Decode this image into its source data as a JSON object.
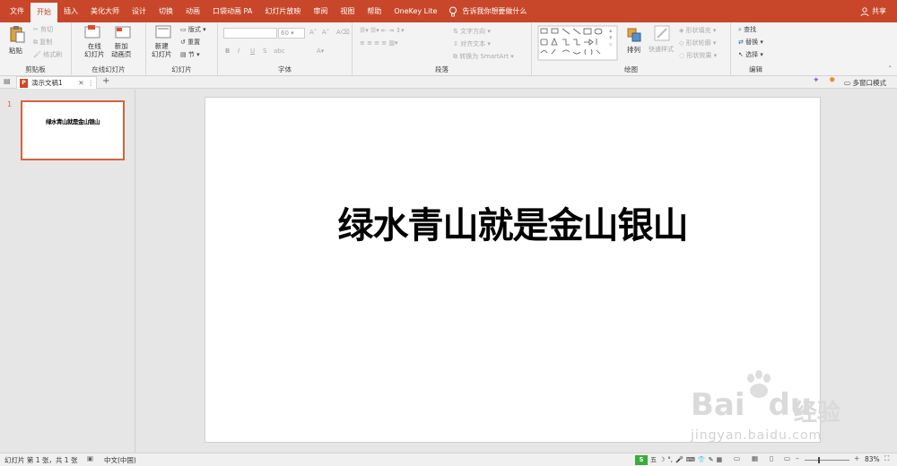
{
  "menubar": {
    "tabs": [
      "文件",
      "开始",
      "插入",
      "美化大师",
      "设计",
      "切换",
      "动画",
      "口袋动画 PA",
      "幻灯片放映",
      "审阅",
      "视图",
      "帮助",
      "OneKey Lite"
    ],
    "active_tab": "开始",
    "tell_me": "告诉我你想要做什么",
    "share": "共享"
  },
  "ribbon": {
    "clipboard": {
      "paste": "粘贴",
      "cut": "剪切",
      "copy": "复制",
      "format_painter": "格式刷",
      "group": "剪贴板"
    },
    "online_slides": {
      "online": "在线",
      "online2": "幻灯片",
      "new_anim": "新加",
      "new_anim2": "动画页",
      "group": "在线幻灯片"
    },
    "slides": {
      "new": "新建",
      "new2": "幻灯片",
      "layout": "版式",
      "reset": "重置",
      "section": "节",
      "group": "幻灯片"
    },
    "font": {
      "size": "60",
      "group": "字体",
      "bold": "B",
      "italic": "I",
      "underline": "U",
      "strike": "S",
      "shadow": "abc"
    },
    "paragraph": {
      "text_direction": "文字方向",
      "align_text": "对齐文本",
      "smartart": "转换为 SmartArt",
      "group": "段落"
    },
    "drawing": {
      "arrange": "排列",
      "quick_styles": "快速样式",
      "shape_fill": "形状填充",
      "shape_outline": "形状轮廓",
      "shape_effects": "形状效果",
      "group": "绘图"
    },
    "editing": {
      "find": "查找",
      "replace": "替换",
      "select": "选择",
      "group": "编辑"
    }
  },
  "tabbar": {
    "doc_title": "演示文稿1",
    "multi_window": "多窗口模式"
  },
  "thumbnails": [
    {
      "number": "1",
      "text": "绿水青山就是金山银山"
    }
  ],
  "slide": {
    "title": "绿水青山就是金山银山"
  },
  "status": {
    "slide_info": "幻灯片 第 1 张，共 1 张",
    "language": "中文(中国)",
    "zoom": "83%",
    "ime": "五"
  },
  "watermark": {
    "brand": "Bai",
    "brand2": "du",
    "jingyan": "经验",
    "url": "jingyan.baidu.com"
  },
  "colors": {
    "accent": "#c8472a",
    "ribbon_bg": "#f3f3f3",
    "workspace": "#e6e6e6",
    "thumb_border": "#d6633c"
  }
}
